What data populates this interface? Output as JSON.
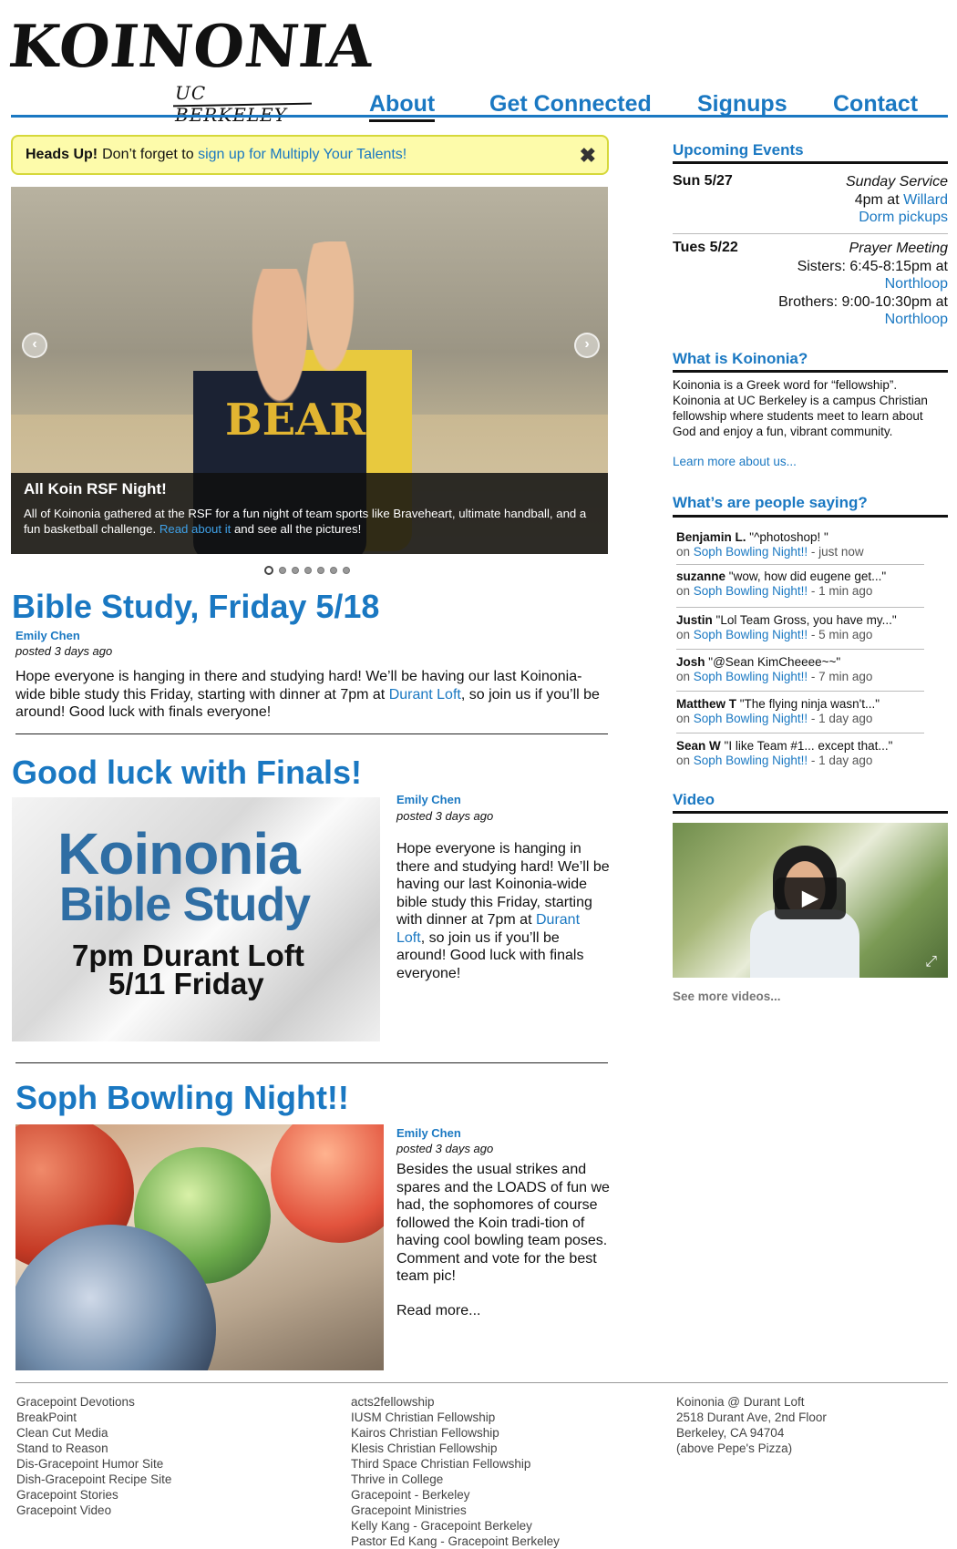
{
  "header": {
    "logo_word": "KOINONIA",
    "logo_sub": "UC BERKELEY",
    "nav": [
      {
        "label": "About",
        "active": true
      },
      {
        "label": "Get Connected",
        "active": false
      },
      {
        "label": "Signups",
        "active": false
      },
      {
        "label": "Contact",
        "active": false
      }
    ]
  },
  "alert": {
    "strong": "Heads Up!",
    "text": "Don’t forget to",
    "link": "sign up for Multiply Your Talents!",
    "close_icon": "close-icon"
  },
  "slideshow": {
    "caption_title": "All Koin RSF Night!",
    "caption_text": "All of Koinonia gathered at the RSF for a fun night of team sports like Braveheart, ultimate handball, and a fun basketball challenge.",
    "caption_link": "Read about it",
    "caption_tail": "and see all the pictures!",
    "shirt_text": "BEAR",
    "dots": 7,
    "active_dot": 0
  },
  "posts": [
    {
      "title": "Bible Study, Friday 5/18",
      "author": "Emily Chen",
      "posted": "posted 3 days ago",
      "body_pre": "Hope everyone is hanging in there and studying hard! We’ll be having our last Koinonia-wide bible study this Friday, starting with dinner at 7pm at",
      "body_link": "Durant Loft",
      "body_post": ", so join us if you’ll be around! Good luck with finals everyone!"
    },
    {
      "title": "Good luck with Finals!",
      "author": "Emily Chen",
      "posted": "posted 3 days ago",
      "image_lines": [
        "Koinonia",
        "Bible Study",
        "7pm Durant Loft",
        "5/11 Friday"
      ],
      "body_pre": "Hope everyone is hanging in there and studying hard! We’ll be having our last Koinonia-wide bible study this Friday, starting with dinner at 7pm at",
      "body_link": "Durant Loft",
      "body_post": ", so join us if you’ll be around! Good luck with finals everyone!"
    },
    {
      "title": "Soph Bowling Night!!",
      "author": "Emily Chen",
      "posted": "posted 3 days ago",
      "body": "Besides the usual strikes and spares and the LOADS of fun we had, the sophomores of course followed the Koin tradi-tion of having cool bowling team poses. Comment and vote for the best team pic!",
      "read_more": "Read more..."
    }
  ],
  "sidebar": {
    "events_heading": "Upcoming Events",
    "events": [
      {
        "date": "Sun 5/27",
        "title": "Sunday Service",
        "line1_pre": "4pm at",
        "line1_link": "Willard",
        "line2_link": "Dorm pickups"
      },
      {
        "date": "Tues 5/22",
        "title": "Prayer Meeting",
        "line1_pre": "Sisters: 6:45-8:15pm at",
        "line1_link": "Northloop",
        "line2_pre": "Brothers: 9:00-10:30pm at",
        "line2_link": "Northloop"
      }
    ],
    "about_heading": "What is Koinonia?",
    "about_text": "Koinonia is a Greek word for “fellowship”. Koinonia at UC Berkeley is a campus Christian fellowship where students meet to learn about God and enjoy a fun, vibrant community.",
    "about_link": "Learn more about us...",
    "comments_heading": "What’s are people saying?",
    "comments": [
      {
        "name": "Benjamin L.",
        "text": "\"^photoshop! \"",
        "on": "on",
        "link": "Soph Bowling Night!!",
        "time": "- just now"
      },
      {
        "name": "suzanne",
        "text": "\"wow, how did eugene get...\"",
        "on": "on",
        "link": "Soph Bowling Night!!",
        "time": "- 1 min ago"
      },
      {
        "name": "Justin",
        "text": "\"Lol Team Gross, you have my...\"",
        "on": "on",
        "link": "Soph Bowling Night!!",
        "time": "- 5 min ago"
      },
      {
        "name": "Josh",
        "text": "\"@Sean KimCheeee~~\"",
        "on": "on",
        "link": "Soph Bowling Night!!",
        "time": "- 7 min ago"
      },
      {
        "name": "Matthew T",
        "text": "\"The flying ninja wasn't...\"",
        "on": "on",
        "link": "Soph Bowling Night!!",
        "time": "- 1 day ago"
      },
      {
        "name": "Sean W",
        "text": "\"I like Team #1... except that...\"",
        "on": "on",
        "link": "Soph Bowling Night!!",
        "time": "- 1 day ago"
      }
    ],
    "video_heading": "Video",
    "video_link": "See more videos..."
  },
  "footer": {
    "col1": [
      "Gracepoint Devotions",
      "BreakPoint",
      "Clean Cut Media",
      "Stand to Reason",
      "Dis-Gracepoint Humor Site",
      "Dish-Gracepoint Recipe Site",
      "Gracepoint Stories",
      "Gracepoint Video"
    ],
    "col2": [
      "acts2fellowship",
      "IUSM Christian Fellowship",
      "Kairos Christian Fellowship",
      "Klesis Christian Fellowship",
      "Third Space Christian Fellowship",
      "Thrive in College",
      "Gracepoint - Berkeley",
      "Gracepoint Ministries",
      "Kelly Kang - Gracepoint Berkeley",
      "Pastor Ed Kang - Gracepoint Berkeley"
    ],
    "col3": [
      "Koinonia @ Durant Loft",
      "2518 Durant Ave, 2nd Floor",
      "Berkeley, CA 94704",
      "(above Pepe's Pizza)"
    ]
  }
}
